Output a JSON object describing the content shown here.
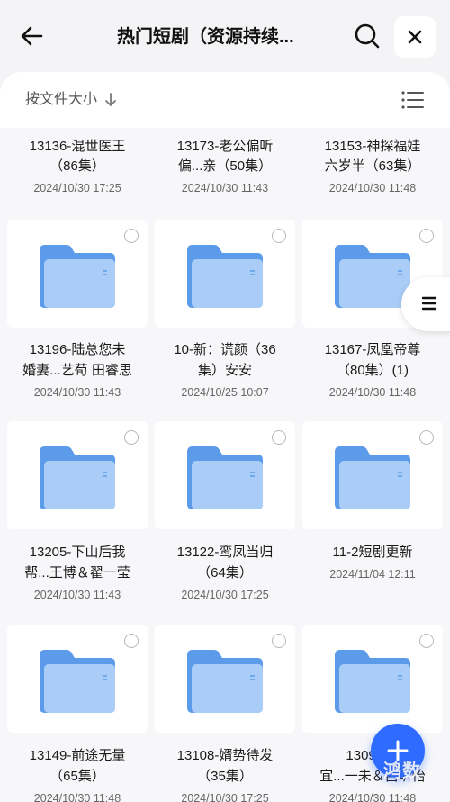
{
  "header": {
    "title": "热门短剧（资源持续..."
  },
  "sortbar": {
    "label": "按文件大小"
  },
  "watermark": "鸿数",
  "files": [
    {
      "name_line1": "13136-混世医王",
      "name_line2": "（86集）",
      "date": "2024/10/30 17:25"
    },
    {
      "name_line1": "13173-老公偏听",
      "name_line2": "偏...亲（50集）",
      "date": "2024/10/30 11:43"
    },
    {
      "name_line1": "13153-神探福娃",
      "name_line2": "六岁半（63集）",
      "date": "2024/10/30 11:48"
    },
    {
      "name_line1": "13196-陆总您未",
      "name_line2": "婚妻...艺荀 田睿思",
      "date": "2024/10/30 11:43"
    },
    {
      "name_line1": "10-新：谎颜（36",
      "name_line2": "集）安安",
      "date": "2024/10/25 10:07"
    },
    {
      "name_line1": "13167-凤凰帝尊",
      "name_line2": "（80集）(1)",
      "date": "2024/10/30 11:48"
    },
    {
      "name_line1": "13205-下山后我",
      "name_line2": "帮...王博＆翟一莹",
      "date": "2024/10/30 11:43"
    },
    {
      "name_line1": "13122-鸾凤当归",
      "name_line2": "（64集）",
      "date": "2024/10/30 17:25"
    },
    {
      "name_line1": "11-2短剧更新",
      "name_line2": "",
      "date": "2024/11/04 12:11"
    },
    {
      "name_line1": "13149-前途无量",
      "name_line2": "（65集）",
      "date": "2024/10/30 11:48"
    },
    {
      "name_line1": "13108-婿势待发",
      "name_line2": "（35集）",
      "date": "2024/10/30 17:25"
    },
    {
      "name_line1": "13098-...",
      "name_line2": "宜...一未＆吕听怡",
      "date": "2024/10/30 11:48"
    }
  ]
}
